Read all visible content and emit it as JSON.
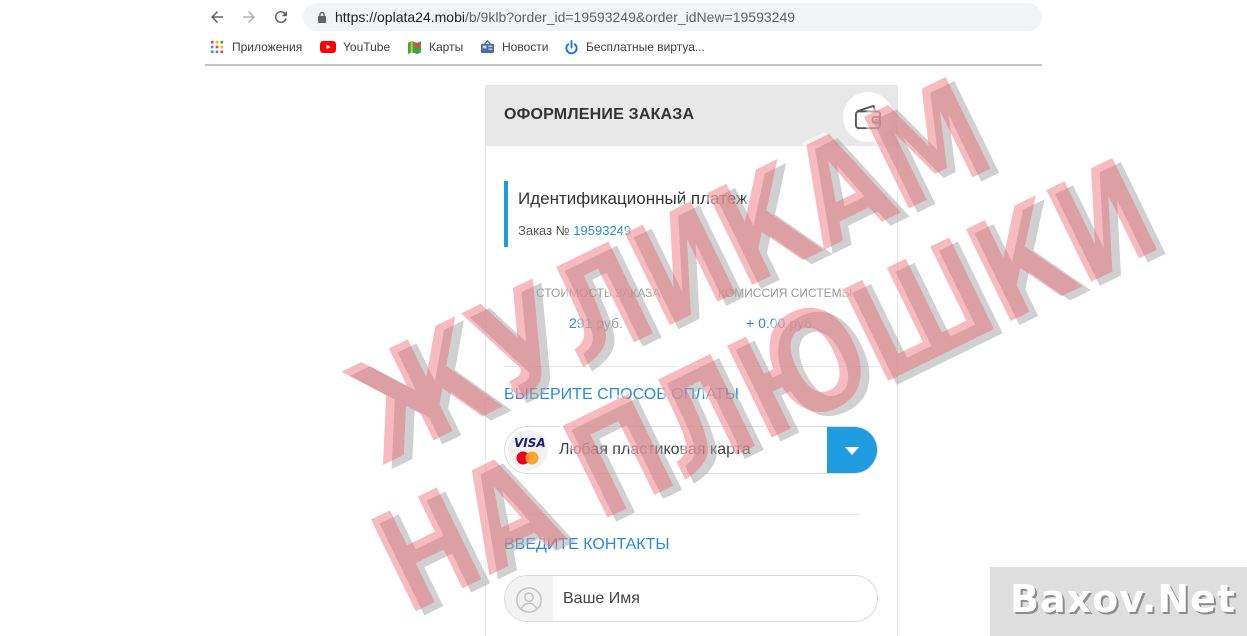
{
  "browser": {
    "url_host": "https://oplata24.mobi",
    "url_path": "/b/9klb?order_id=19593249&order_idNew=19593249",
    "bookmarks": [
      {
        "label": "Приложения",
        "icon": "apps-icon"
      },
      {
        "label": "YouTube",
        "icon": "youtube-icon"
      },
      {
        "label": "Карты",
        "icon": "maps-icon"
      },
      {
        "label": "Новости",
        "icon": "news-icon"
      },
      {
        "label": "Бесплатные виртуа...",
        "icon": "power-icon"
      }
    ]
  },
  "order": {
    "header_title": "ОФОРМЛЕНИЕ ЗАКАЗА",
    "payment_name": "Идентификационный платеж",
    "order_label": "Заказ №",
    "order_number": "19593249",
    "cost_label": "СТОИМОСТЬ ЗАКАЗА",
    "cost_value": "291",
    "cost_unit": "руб.",
    "fee_label": "КОМИССИЯ СИСТЕМЫ",
    "fee_value": "+ 0.00",
    "fee_unit": "руб."
  },
  "payment_method": {
    "section_title": "ВЫБЕРИТЕ СПОСОБ ОПЛАТЫ",
    "selected": "Любая пластиковая карта",
    "card_logo_text": "VISA"
  },
  "contacts": {
    "section_title": "ВВЕДИТЕ КОНТАКТЫ",
    "name_placeholder": "Ваше Имя"
  },
  "watermark": {
    "line1": "ЖУЛИКАМ",
    "line2": "НА ПЛЮШКИ",
    "site": "Baxov.Net"
  },
  "colors": {
    "accent": "#1e9cdf",
    "link": "#2a8bd8",
    "stamp": "#eb5a64"
  }
}
